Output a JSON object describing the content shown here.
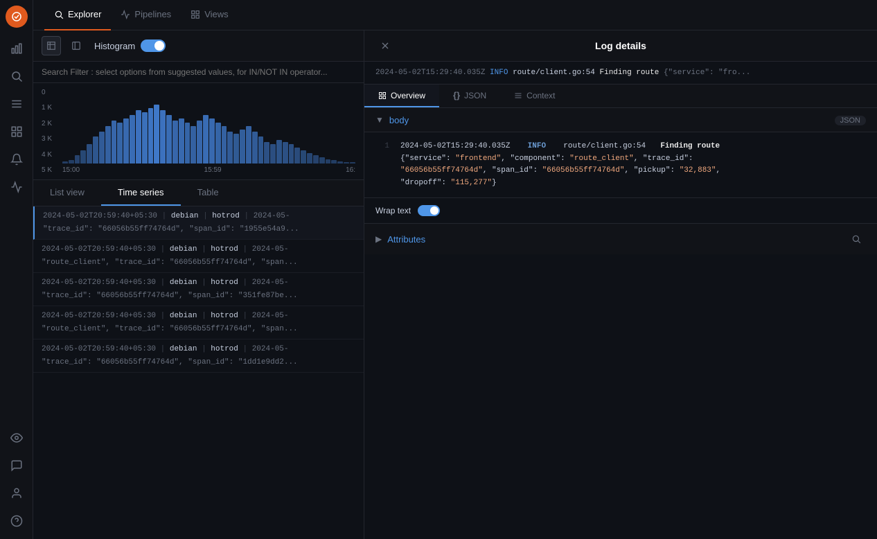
{
  "app": {
    "title": "Log details"
  },
  "sidebar": {
    "logo": "G",
    "icons": [
      "chart-bar",
      "search",
      "list",
      "grid",
      "bell",
      "gear",
      "eye",
      "message",
      "user",
      "help"
    ]
  },
  "topnav": {
    "tabs": [
      {
        "id": "explorer",
        "label": "Explorer",
        "active": true
      },
      {
        "id": "pipelines",
        "label": "Pipelines",
        "active": false
      },
      {
        "id": "views",
        "label": "Views",
        "active": false
      }
    ]
  },
  "toolbar": {
    "histogram_label": "Histogram"
  },
  "search": {
    "placeholder": "Search Filter : select options from suggested values, for IN/NOT IN operator..."
  },
  "histogram": {
    "y_labels": [
      "5 K",
      "4 K",
      "3 K",
      "2 K",
      "1 K",
      "0"
    ],
    "x_labels": [
      "15:00",
      "15:59",
      "16:"
    ],
    "bars": [
      2,
      3,
      8,
      12,
      18,
      25,
      30,
      35,
      40,
      38,
      42,
      45,
      50,
      48,
      52,
      55,
      50,
      45,
      40,
      42,
      38,
      35,
      40,
      45,
      42,
      38,
      35,
      30,
      28,
      32,
      35,
      30,
      25,
      20,
      18,
      22,
      20,
      18,
      15,
      12,
      10,
      8,
      6,
      4,
      3,
      2,
      1,
      1
    ]
  },
  "view_tabs": {
    "tabs": [
      {
        "id": "list",
        "label": "List view",
        "active": false
      },
      {
        "id": "timeseries",
        "label": "Time series",
        "active": true
      },
      {
        "id": "table",
        "label": "Table",
        "active": false
      }
    ]
  },
  "log_entries": [
    {
      "id": 1,
      "time": "2024-05-02T20:59:40+05:30",
      "sep1": "|",
      "host": "debian",
      "sep2": "|",
      "app": "hotrod",
      "sep3": "|",
      "preview": "2024-05-",
      "detail": "\"trace_id\": \"66056b55ff74764d\", \"span_id\": \"1955e54a9..."
    },
    {
      "id": 2,
      "time": "2024-05-02T20:59:40+05:30",
      "sep1": "|",
      "host": "debian",
      "sep2": "|",
      "app": "hotrod",
      "sep3": "|",
      "preview": "2024-05-",
      "detail": "\"route_client\", \"trace_id\": \"66056b55ff74764d\", \"span..."
    },
    {
      "id": 3,
      "time": "2024-05-02T20:59:40+05:30",
      "sep1": "|",
      "host": "debian",
      "sep2": "|",
      "app": "hotrod",
      "sep3": "|",
      "preview": "2024-05-",
      "detail": "\"trace_id\": \"66056b55ff74764d\", \"span_id\": \"351fe87be..."
    },
    {
      "id": 4,
      "time": "2024-05-02T20:59:40+05:30",
      "sep1": "|",
      "host": "debian",
      "sep2": "|",
      "app": "hotrod",
      "sep3": "|",
      "preview": "2024-05-",
      "detail": "\"route_client\", \"trace_id\": \"66056b55ff74764d\", \"span..."
    },
    {
      "id": 5,
      "time": "2024-05-02T20:59:40+05:30",
      "sep1": "|",
      "host": "debian",
      "sep2": "|",
      "app": "hotrod",
      "sep3": "|",
      "preview": "2024-05-",
      "detail": "\"trace_id\": \"66056b55ff74764d\", \"span_id\": \"1dd1e9dd2..."
    }
  ],
  "detail_panel": {
    "title": "Log details",
    "banner": "2024-05-02T15:29:40.035Z  INFO  route/client.go:54  Finding route  {\"service\": \"fro...",
    "banner_ts": "2024-05-02T15:29:40.035Z",
    "banner_level": "INFO",
    "banner_path": "route/client.go:54",
    "banner_msg": "Finding route",
    "tabs": [
      {
        "id": "overview",
        "label": "Overview",
        "active": true,
        "icon": "grid"
      },
      {
        "id": "json",
        "label": "JSON",
        "active": false,
        "icon": "braces"
      },
      {
        "id": "context",
        "label": "Context",
        "active": false,
        "icon": "list"
      }
    ],
    "body_section": {
      "label": "body",
      "badge_label": "JSON",
      "expanded": true,
      "line_number": "1",
      "code_ts": "2024-05-02T15:29:40.035Z",
      "code_level": "INFO",
      "code_path": "route/client.go:54",
      "code_msg": "Finding route",
      "code_line2": "{\"service\": \"frontend\", \"component\": \"route_client\", \"trace_id\":",
      "code_line3": "\"66056b55ff74764d\", \"span_id\": \"66056b55ff74764d\", \"pickup\": \"32,883\",",
      "code_line4": "\"dropoff\": \"115,277\"}"
    },
    "wrap_text": {
      "label": "Wrap text",
      "enabled": true
    },
    "attributes_section": {
      "label": "Attributes",
      "expanded": false
    }
  }
}
